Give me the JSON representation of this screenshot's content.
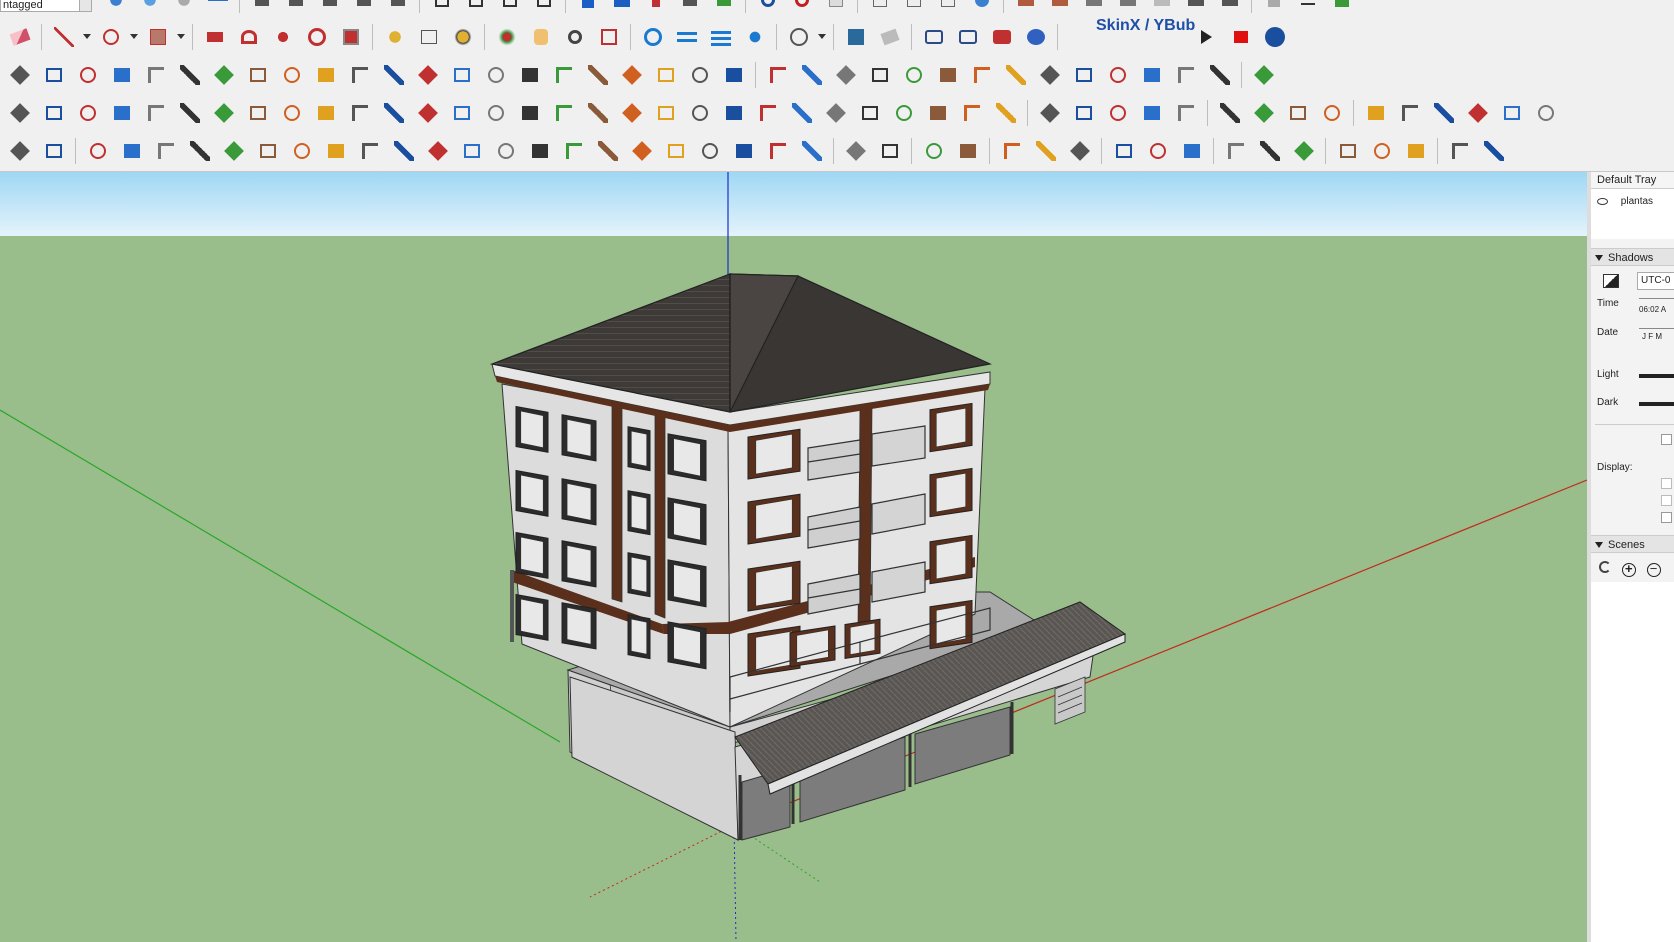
{
  "toolbar": {
    "tag_dropdown_value": "ntagged",
    "skinx_label": "SkinX / YBub"
  },
  "tray": {
    "title": "Default Tray",
    "tags_item": "plantas",
    "shadows": {
      "header": "Shadows",
      "utc_value": "UTC-0",
      "time_label": "Time",
      "time_value": "06:02 A",
      "date_label": "Date",
      "date_months": "J F M",
      "light_label": "Light",
      "dark_label": "Dark",
      "display_label": "Display:"
    },
    "scenes": {
      "header": "Scenes"
    }
  },
  "colors": {
    "sky_top": "#9fd7f4",
    "sky_bottom": "#e4f3fb",
    "ground": "#9abd8c",
    "axis_blue": "#1d2fc6",
    "axis_green": "#28a828",
    "axis_red": "#c02a1a",
    "roof": "#3c3836",
    "wall": "#d8d8d8",
    "trim_brown": "#5a2f1c"
  }
}
